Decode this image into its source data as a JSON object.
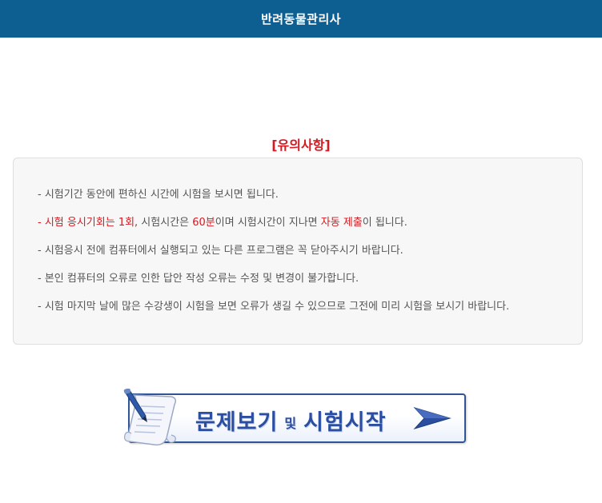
{
  "header": {
    "title": "반려동물관리사"
  },
  "notice": {
    "title": "[유의사항]",
    "items": [
      {
        "text": "- 시험기간 동안에 편하신 시간에 시험을 보시면 됩니다."
      },
      {
        "prefix": "- ",
        "attempts": "시험 응시기회는 1회",
        "mid1": ", 시험시간은 ",
        "duration": "60분",
        "mid2": "이며 시험시간이 지나면 ",
        "auto_submit": "자동 제출",
        "suffix": "이 됩니다."
      },
      {
        "text": "- 시험응시 전에 컴퓨터에서 실행되고 있는 다른 프로그램은 꼭 닫아주시기 바랍니다."
      },
      {
        "text": "- 본인 컴퓨터의 오류로 인한 답안 작성 오류는 수정 및 변경이 불가합니다."
      },
      {
        "text": "- 시험 마지막 날에 많은 수강생이 시험을 보면 오류가 생길 수 있으므로 그전에 미리 시험을 보시기 바랍니다."
      }
    ]
  },
  "start_button": {
    "label_part1": "문제보기",
    "label_small": "및",
    "label_part2": "시험시작",
    "icon": "pen-paper-icon",
    "arrow_icon": "arrow-right-icon"
  },
  "colors": {
    "header_bg": "#0d5e91",
    "accent_red": "#d71920",
    "button_blue": "#2b4ea0"
  }
}
